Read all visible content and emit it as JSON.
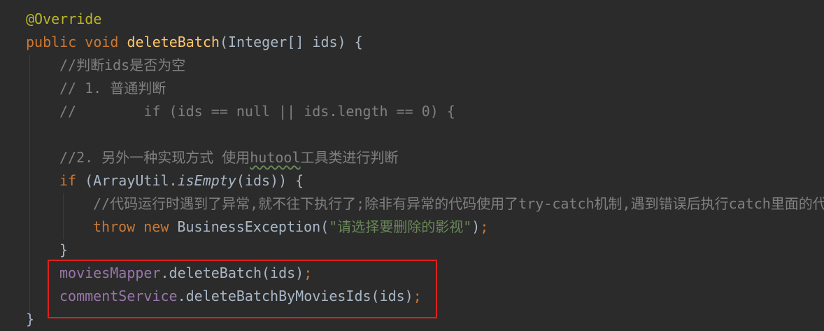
{
  "editor": {
    "highlight_color": "#e0201b",
    "lines": [
      {
        "indent": 0,
        "tokens": [
          {
            "t": "@Override",
            "c": "ann"
          }
        ]
      },
      {
        "indent": 0,
        "tokens": [
          {
            "t": "public void ",
            "c": "kw"
          },
          {
            "t": "deleteBatch",
            "c": "fn"
          },
          {
            "t": "(Integer[] ids) {",
            "c": ""
          }
        ]
      },
      {
        "indent": 1,
        "tokens": [
          {
            "t": "//判断ids是否为空",
            "c": "cm"
          }
        ]
      },
      {
        "indent": 1,
        "tokens": [
          {
            "t": "// 1. 普通判断",
            "c": "cm"
          }
        ]
      },
      {
        "indent": 1,
        "tokens": [
          {
            "t": "//        if (ids == null || ids.length == 0) {",
            "c": "cm"
          }
        ]
      },
      {
        "indent": 0,
        "tokens": []
      },
      {
        "indent": 1,
        "tokens": [
          {
            "t": "//2. 另外一种实现方式 使用",
            "c": "cm"
          },
          {
            "t": "hutool",
            "c": "cm typo"
          },
          {
            "t": "工具类进行判断",
            "c": "cm"
          }
        ]
      },
      {
        "indent": 1,
        "tokens": [
          {
            "t": "if ",
            "c": "kw"
          },
          {
            "t": "(ArrayUtil.",
            "c": ""
          },
          {
            "t": "isEmpty",
            "c": "it"
          },
          {
            "t": "(ids)) {",
            "c": ""
          }
        ]
      },
      {
        "indent": 2,
        "tokens": [
          {
            "t": "//代码运行时遇到了异常,就不往下执行了;除非有异常的代码使用了try-catch机制,遇到错误后执行catch里面的代码",
            "c": "cm"
          }
        ]
      },
      {
        "indent": 2,
        "tokens": [
          {
            "t": "throw new ",
            "c": "kw"
          },
          {
            "t": "BusinessException(",
            "c": ""
          },
          {
            "t": "\"请选择要删除的影视\"",
            "c": "str"
          },
          {
            "t": ")",
            "c": ""
          },
          {
            "t": ";",
            "c": "semi"
          }
        ]
      },
      {
        "indent": 1,
        "tokens": [
          {
            "t": "}",
            "c": ""
          }
        ]
      },
      {
        "indent": 1,
        "tokens": [
          {
            "t": "moviesMapper",
            "c": "fld"
          },
          {
            "t": ".deleteBatch(ids)",
            "c": ""
          },
          {
            "t": ";",
            "c": "semi"
          }
        ]
      },
      {
        "indent": 1,
        "tokens": [
          {
            "t": "commentService",
            "c": "fld"
          },
          {
            "t": ".deleteBatchByMoviesIds(ids)",
            "c": ""
          },
          {
            "t": ";",
            "c": "semi"
          }
        ]
      },
      {
        "indent": 0,
        "tokens": [
          {
            "t": "}",
            "c": ""
          }
        ]
      }
    ]
  }
}
